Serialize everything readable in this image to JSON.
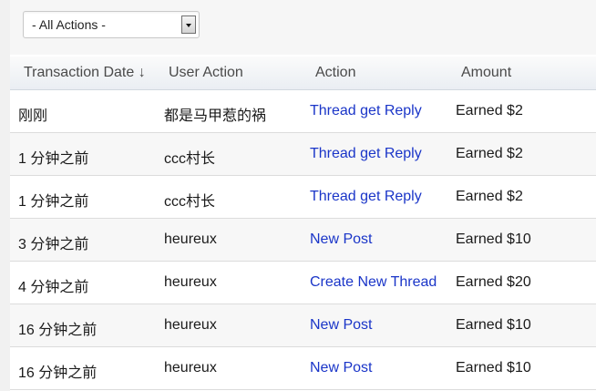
{
  "filter": {
    "selected": "- All Actions -"
  },
  "table": {
    "headers": {
      "date": "Transaction Date ↓",
      "user": "User Action",
      "action": "Action",
      "amount": "Amount"
    },
    "rows": [
      {
        "date": "刚刚",
        "user": "都是马甲惹的祸",
        "action": "Thread get Reply",
        "amount": "Earned $2"
      },
      {
        "date": "1 分钟之前",
        "user": "ccc村长",
        "action": "Thread get Reply",
        "amount": "Earned $2"
      },
      {
        "date": "1 分钟之前",
        "user": "ccc村长",
        "action": "Thread get Reply",
        "amount": "Earned $2"
      },
      {
        "date": "3 分钟之前",
        "user": "heureux",
        "action": "New Post",
        "amount": "Earned $10"
      },
      {
        "date": "4 分钟之前",
        "user": "heureux",
        "action": "Create New Thread",
        "amount": "Earned $20"
      },
      {
        "date": "16 分钟之前",
        "user": "heureux",
        "action": "New Post",
        "amount": "Earned $10"
      },
      {
        "date": "16 分钟之前",
        "user": "heureux",
        "action": "New Post",
        "amount": "Earned $10"
      }
    ]
  },
  "colors": {
    "link": "#1a35c8",
    "header_text": "#4a4a4a",
    "alt_row": "#f7f7f7"
  }
}
